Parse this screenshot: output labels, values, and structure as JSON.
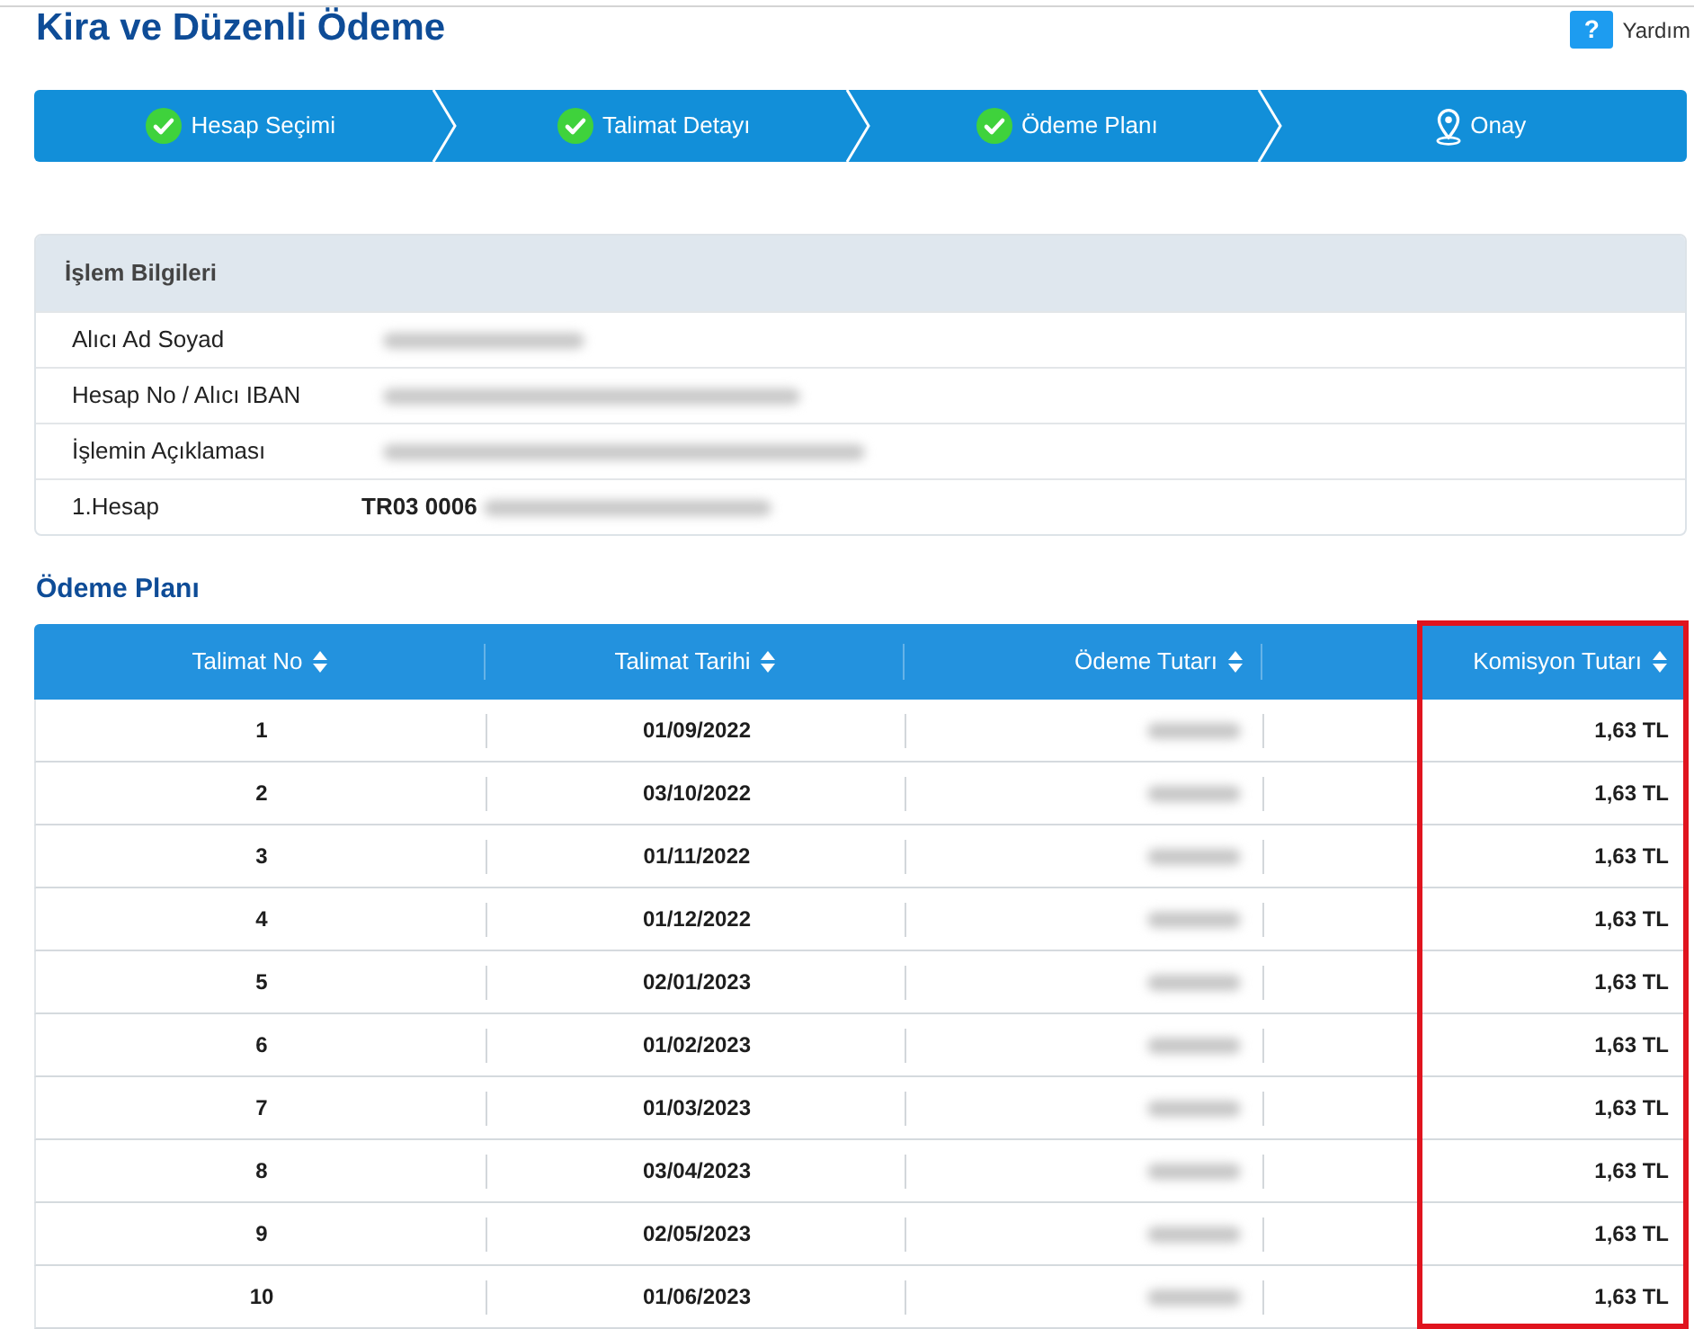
{
  "page": {
    "title": "Kira ve Düzenli Ödeme"
  },
  "help": {
    "icon_text": "?",
    "label": "Yardım"
  },
  "steps": [
    {
      "label": "Hesap Seçimi",
      "completed": true
    },
    {
      "label": "Talimat Detayı",
      "completed": true
    },
    {
      "label": "Ödeme Planı",
      "completed": true
    },
    {
      "label": "Onay",
      "completed": false
    }
  ],
  "info_panel": {
    "title": "İşlem Bilgileri",
    "rows": [
      {
        "label": "Alıcı Ad Soyad",
        "redacted": true
      },
      {
        "label": "Hesap No / Alıcı IBAN",
        "redacted": true
      },
      {
        "label": "İşlemin Açıklaması",
        "redacted": true
      },
      {
        "label": "1.Hesap",
        "value": "TR03 0006",
        "redacted": true
      }
    ]
  },
  "payment_plan": {
    "title": "Ödeme Planı",
    "table": {
      "columns": [
        {
          "label": "Talimat No",
          "highlighted": false
        },
        {
          "label": "Talimat Tarihi",
          "highlighted": false
        },
        {
          "label": "Ödeme Tutarı",
          "highlighted": false
        },
        {
          "label": "Komisyon Tutarı",
          "highlighted": true
        }
      ],
      "rows": [
        {
          "cells": [
            {
              "text": "1"
            },
            {
              "text": "01/09/2022"
            },
            {
              "redacted": true
            },
            {
              "text": "1,63 TL"
            }
          ]
        },
        {
          "cells": [
            {
              "text": "2"
            },
            {
              "text": "03/10/2022"
            },
            {
              "redacted": true
            },
            {
              "text": "1,63 TL"
            }
          ]
        },
        {
          "cells": [
            {
              "text": "3"
            },
            {
              "text": "01/11/2022"
            },
            {
              "redacted": true
            },
            {
              "text": "1,63 TL"
            }
          ]
        },
        {
          "cells": [
            {
              "text": "4"
            },
            {
              "text": "01/12/2022"
            },
            {
              "redacted": true
            },
            {
              "text": "1,63 TL"
            }
          ]
        },
        {
          "cells": [
            {
              "text": "5"
            },
            {
              "text": "02/01/2023"
            },
            {
              "redacted": true
            },
            {
              "text": "1,63 TL"
            }
          ]
        },
        {
          "cells": [
            {
              "text": "6"
            },
            {
              "text": "01/02/2023"
            },
            {
              "redacted": true
            },
            {
              "text": "1,63 TL"
            }
          ]
        },
        {
          "cells": [
            {
              "text": "7"
            },
            {
              "text": "01/03/2023"
            },
            {
              "redacted": true
            },
            {
              "text": "1,63 TL"
            }
          ]
        },
        {
          "cells": [
            {
              "text": "8"
            },
            {
              "text": "03/04/2023"
            },
            {
              "redacted": true
            },
            {
              "text": "1,63 TL"
            }
          ]
        },
        {
          "cells": [
            {
              "text": "9"
            },
            {
              "text": "02/05/2023"
            },
            {
              "redacted": true
            },
            {
              "text": "1,63 TL"
            }
          ]
        },
        {
          "cells": [
            {
              "text": "10"
            },
            {
              "text": "01/06/2023"
            },
            {
              "redacted": true
            },
            {
              "text": "1,63 TL"
            }
          ]
        }
      ]
    }
  }
}
